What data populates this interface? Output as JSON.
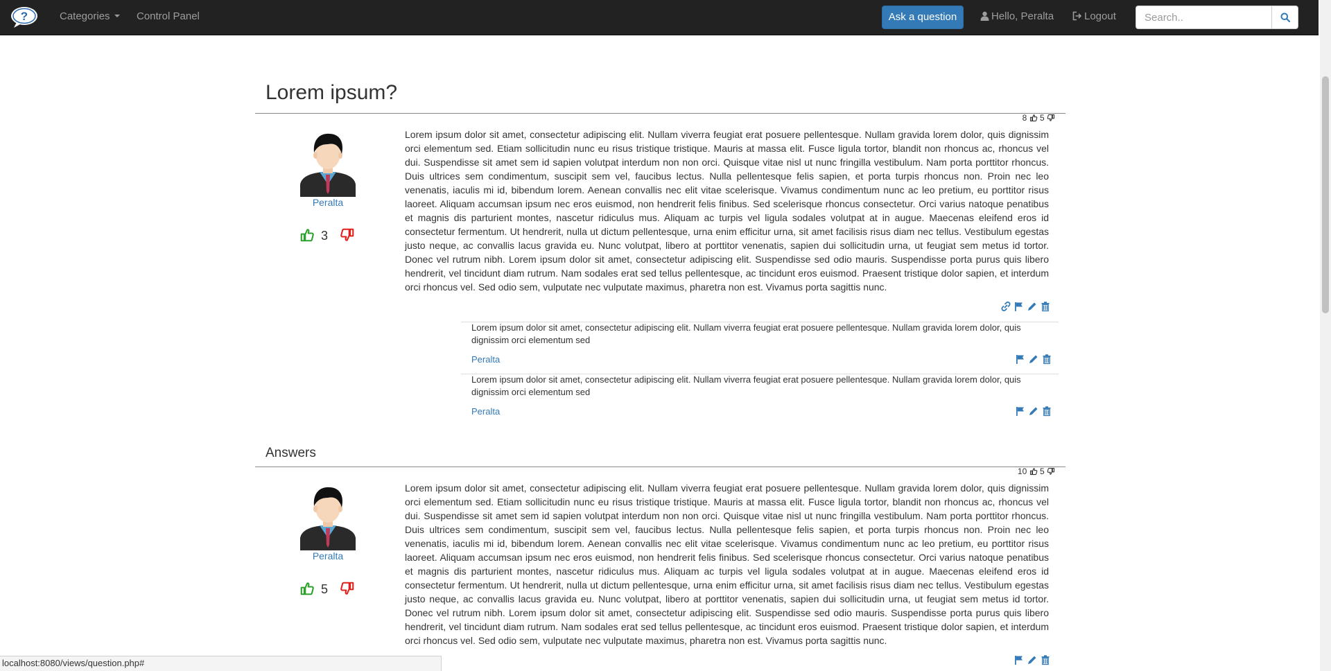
{
  "navbar": {
    "categories_label": "Categories",
    "control_panel_label": "Control Panel",
    "ask_label": "Ask a question",
    "hello_label": "Hello, Peralta",
    "logout_label": "Logout",
    "search_placeholder": "Search.."
  },
  "question": {
    "title": "Lorem ipsum?",
    "likes": "8",
    "dislikes": "5",
    "author": "Peralta",
    "score": "3",
    "body": "Lorem ipsum dolor sit amet, consectetur adipiscing elit. Nullam viverra feugiat erat posuere pellentesque. Nullam gravida lorem dolor, quis dignissim orci elementum sed. Etiam sollicitudin nunc eu risus tristique tristique. Mauris at massa elit. Fusce ligula tortor, blandit non rhoncus ac, rhoncus vel dui. Suspendisse sit amet sem id sapien volutpat interdum non non orci. Quisque vitae nisl ut nunc fringilla vestibulum. Nam porta porttitor rhoncus. Duis ultrices sem condimentum, suscipit sem vel, faucibus lectus. Nulla pellentesque felis sapien, et porta turpis rhoncus non. Proin nec leo venenatis, iaculis mi id, bibendum lorem. Aenean convallis nec elit vitae scelerisque. Vivamus condimentum nunc ac leo pretium, eu porttitor risus laoreet. Aliquam accumsan ipsum nec eros euismod, non hendrerit felis finibus. Sed scelerisque rhoncus consectetur. Orci varius natoque penatibus et magnis dis parturient montes, nascetur ridiculus mus. Aliquam ac turpis vel ligula sodales volutpat at in augue. Maecenas eleifend eros id consectetur fermentum. Ut hendrerit, nulla ut dictum pellentesque, urna enim efficitur urna, sit amet facilisis risus diam nec tellus. Vestibulum egestas justo neque, ac convallis lacus gravida eu. Nunc volutpat, libero at porttitor venenatis, sapien dui sollicitudin urna, ut feugiat sem metus id tortor. Donec vel rutrum nibh. Lorem ipsum dolor sit amet, consectetur adipiscing elit. Suspendisse sed odio mauris. Suspendisse porta purus quis libero hendrerit, vel tincidunt diam rutrum. Nam sodales erat sed tellus pellentesque, ac tincidunt eros euismod. Praesent tristique dolor sapien, et interdum orci rhoncus vel. Sed odio sem, vulputate nec vulputate maximus, pharetra non est. Vivamus porta sagittis nunc.",
    "comments": [
      {
        "text": "Lorem ipsum dolor sit amet, consectetur adipiscing elit. Nullam viverra feugiat erat posuere pellentesque. Nullam gravida lorem dolor, quis dignissim orci elementum sed",
        "author": "Peralta"
      },
      {
        "text": "Lorem ipsum dolor sit amet, consectetur adipiscing elit. Nullam viverra feugiat erat posuere pellentesque. Nullam gravida lorem dolor, quis dignissim orci elementum sed",
        "author": "Peralta"
      }
    ]
  },
  "answers": {
    "title": "Answers",
    "items": [
      {
        "likes": "10",
        "dislikes": "5",
        "author": "Peralta",
        "score": "5",
        "body": "Lorem ipsum dolor sit amet, consectetur adipiscing elit. Nullam viverra feugiat erat posuere pellentesque. Nullam gravida lorem dolor, quis dignissim orci elementum sed. Etiam sollicitudin nunc eu risus tristique tristique. Mauris at massa elit. Fusce ligula tortor, blandit non rhoncus ac, rhoncus vel dui. Suspendisse sit amet sem id sapien volutpat interdum non non orci. Quisque vitae nisl ut nunc fringilla vestibulum. Nam porta porttitor rhoncus. Duis ultrices sem condimentum, suscipit sem vel, faucibus lectus. Nulla pellentesque felis sapien, et porta turpis rhoncus non. Proin nec leo venenatis, iaculis mi id, bibendum lorem. Aenean convallis nec elit vitae scelerisque. Vivamus condimentum nunc ac leo pretium, eu porttitor risus laoreet. Aliquam accumsan ipsum nec eros euismod, non hendrerit felis finibus. Sed scelerisque rhoncus consectetur. Orci varius natoque penatibus et magnis dis parturient montes, nascetur ridiculus mus. Aliquam ac turpis vel ligula sodales volutpat at in augue. Maecenas eleifend eros id consectetur fermentum. Ut hendrerit, nulla ut dictum pellentesque, urna enim efficitur urna, sit amet facilisis risus diam nec tellus. Vestibulum egestas justo neque, ac convallis lacus gravida eu. Nunc volutpat, libero at porttitor venenatis, sapien dui sollicitudin urna, ut feugiat sem metus id tortor. Donec vel rutrum nibh. Lorem ipsum dolor sit amet, consectetur adipiscing elit. Suspendisse sed odio mauris. Suspendisse porta purus quis libero hendrerit, vel tincidunt diam rutrum. Nam sodales erat sed tellus pellentesque, ac tincidunt eros euismod. Praesent tristique dolor sapien, et interdum orci rhoncus vel. Sed odio sem, vulputate nec vulputate maximus, pharetra non est. Vivamus porta sagittis nunc."
      }
    ]
  },
  "status_bar": {
    "url": "localhost:8080/views/question.php#"
  },
  "icons": {
    "brand": "question-bubble-icon",
    "user": "user-icon",
    "logout": "logout-icon",
    "search": "search-icon",
    "thumbs_up": "thumbs-up-icon",
    "thumbs_down": "thumbs-down-icon",
    "link": "link-icon",
    "flag": "flag-icon",
    "edit": "pencil-icon",
    "delete": "trash-icon"
  },
  "colors": {
    "navbar_bg": "#222222",
    "nav_text": "#9d9d9d",
    "primary": "#337ab7",
    "upvote": "#2ca02c",
    "downvote": "#e0201b"
  }
}
